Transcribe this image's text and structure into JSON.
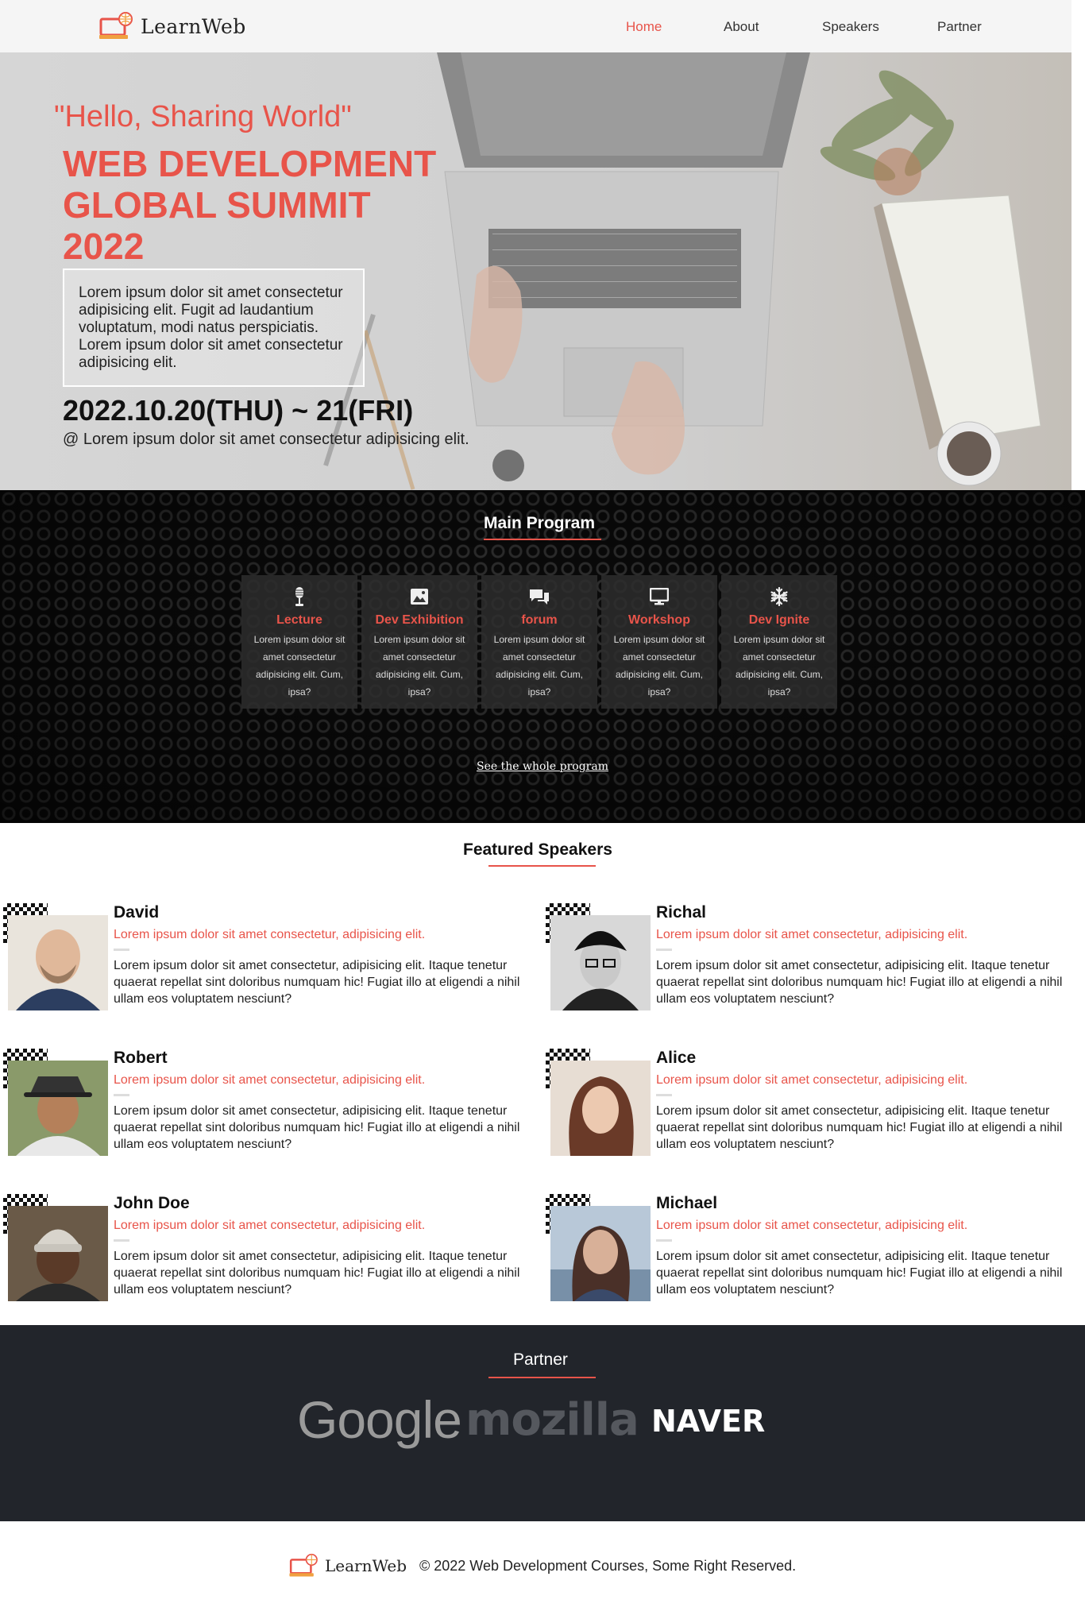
{
  "nav": {
    "logo_text": "LearnWeb",
    "items": [
      {
        "label": "Home",
        "active": true
      },
      {
        "label": "About",
        "active": false
      },
      {
        "label": "Speakers",
        "active": false
      },
      {
        "label": "Partner",
        "active": false
      }
    ]
  },
  "hero": {
    "tagline": "\"Hello, Sharing World\"",
    "title_lines": [
      "WEB DEVELOPMENT",
      "GLOBAL SUMMIT",
      "2022"
    ],
    "description": "Lorem ipsum dolor sit amet consectetur adipisicing elit. Fugit ad laudantium voluptatum, modi natus perspiciatis. Lorem ipsum dolor sit amet consectetur adipisicing elit.",
    "date": "2022.10.20(THU) ~ 21(FRI)",
    "venue": "@ Lorem ipsum dolor sit amet consectetur adipisicing elit."
  },
  "program": {
    "title": "Main Program",
    "cards": [
      {
        "icon": "microphone-icon",
        "title": "Lecture",
        "desc": "Lorem ipsum dolor sit amet consectetur adipisicing elit. Cum, ipsa?"
      },
      {
        "icon": "image-icon",
        "title": "Dev Exhibition",
        "desc": "Lorem ipsum dolor sit amet consectetur adipisicing elit. Cum, ipsa?"
      },
      {
        "icon": "chat-icon",
        "title": "forum",
        "desc": "Lorem ipsum dolor sit amet consectetur adipisicing elit. Cum, ipsa?"
      },
      {
        "icon": "monitor-icon",
        "title": "Workshop",
        "desc": "Lorem ipsum dolor sit amet consectetur adipisicing elit. Cum, ipsa?"
      },
      {
        "icon": "snowflake-icon",
        "title": "Dev Ignite",
        "desc": "Lorem ipsum dolor sit amet consectetur adipisicing elit. Cum, ipsa?"
      }
    ],
    "link": "See the whole program"
  },
  "speakers": {
    "title": "Featured Speakers",
    "items": [
      {
        "name": "David",
        "role": "Lorem ipsum dolor sit amet consectetur, adipisicing elit.",
        "bio": "Lorem ipsum dolor sit amet consectetur, adipisicing elit. Itaque tenetur quaerat repellat sint doloribus numquam hic! Fugiat illo at eligendi a nihil ullam eos voluptatem nesciunt?"
      },
      {
        "name": "Richal",
        "role": "Lorem ipsum dolor sit amet consectetur, adipisicing elit.",
        "bio": "Lorem ipsum dolor sit amet consectetur, adipisicing elit. Itaque tenetur quaerat repellat sint doloribus numquam hic! Fugiat illo at eligendi a nihil ullam eos voluptatem nesciunt?"
      },
      {
        "name": "Robert",
        "role": "Lorem ipsum dolor sit amet consectetur, adipisicing elit.",
        "bio": "Lorem ipsum dolor sit amet consectetur, adipisicing elit. Itaque tenetur quaerat repellat sint doloribus numquam hic! Fugiat illo at eligendi a nihil ullam eos voluptatem nesciunt?"
      },
      {
        "name": "Alice",
        "role": "Lorem ipsum dolor sit amet consectetur, adipisicing elit.",
        "bio": "Lorem ipsum dolor sit amet consectetur, adipisicing elit. Itaque tenetur quaerat repellat sint doloribus numquam hic! Fugiat illo at eligendi a nihil ullam eos voluptatem nesciunt?"
      },
      {
        "name": "John Doe",
        "role": "Lorem ipsum dolor sit amet consectetur, adipisicing elit.",
        "bio": "Lorem ipsum dolor sit amet consectetur, adipisicing elit. Itaque tenetur quaerat repellat sint doloribus numquam hic! Fugiat illo at eligendi a nihil ullam eos voluptatem nesciunt?"
      },
      {
        "name": "Michael",
        "role": "Lorem ipsum dolor sit amet consectetur, adipisicing elit.",
        "bio": "Lorem ipsum dolor sit amet consectetur, adipisicing elit. Itaque tenetur quaerat repellat sint doloribus numquam hic! Fugiat illo at eligendi a nihil ullam eos voluptatem nesciunt?"
      }
    ]
  },
  "partner": {
    "title": "Partner",
    "logos": [
      "Google",
      "mozilla",
      "NAVER"
    ]
  },
  "footer": {
    "logo_text": "LearnWeb",
    "copyright": "© 2022 Web Development Courses, Some Right Reserved."
  },
  "colors": {
    "accent": "#e8544a",
    "dark": "#22252b",
    "nav_bg": "#f5f5f5"
  }
}
